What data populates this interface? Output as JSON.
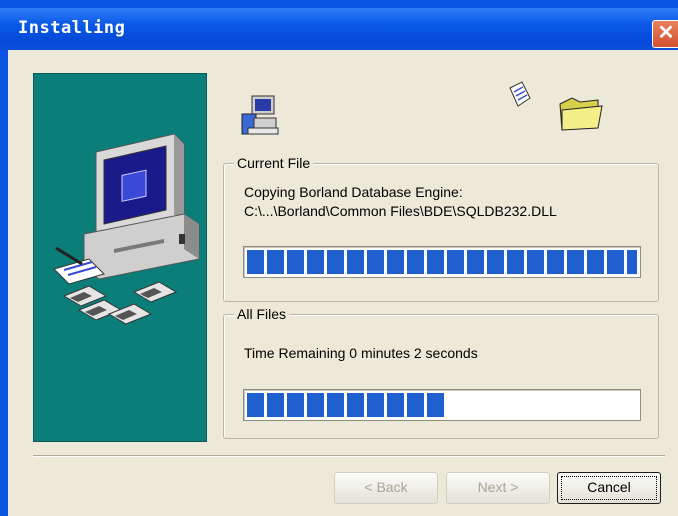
{
  "window": {
    "title": "Installing",
    "close_glyph": "✕"
  },
  "icons": {
    "computer": "computer-monitor-icon",
    "floppies": "floppy-disks-icon",
    "document": "document-icon",
    "folder": "folder-icon",
    "setup": "setup-computer-icon"
  },
  "current_file": {
    "legend": "Current File",
    "line1": "Copying Borland Database Engine:",
    "line2": "C:\\...\\Borland\\Common Files\\BDE\\SQLDB232.DLL",
    "progress_fraction": 1.0
  },
  "all_files": {
    "legend": "All Files",
    "status": "Time Remaining 0 minutes 2 seconds",
    "progress_fraction": 0.5
  },
  "buttons": {
    "back": "< Back",
    "next": "Next >",
    "cancel": "Cancel"
  },
  "colors": {
    "progress_blue": "#1f5fd0",
    "banner_teal": "#0b7e7a",
    "dialog_bg": "#ece9d8"
  }
}
